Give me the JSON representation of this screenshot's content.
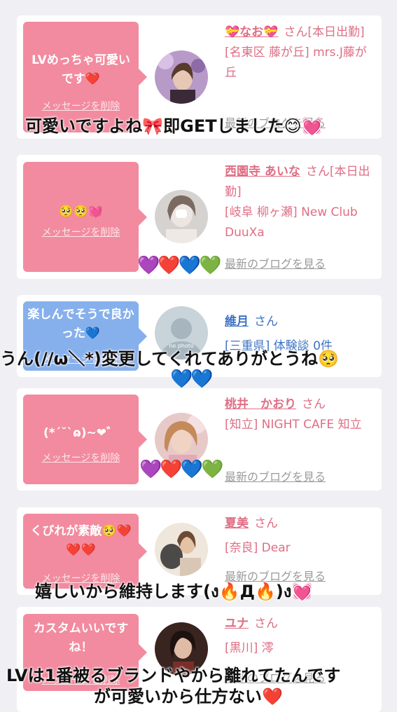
{
  "cards": [
    {
      "bubble_message": "LVめっちゃ可愛いです❤️",
      "delete_label": "メッセージを削除",
      "name": "💝なお💝",
      "honorific": "さん[本日出勤]",
      "place": "[名東区 藤が丘] mrs.J藤が丘",
      "blog_label": "最新のブログを見る"
    },
    {
      "bubble_message": "🥺🥺💓",
      "delete_label": "メッセージを削除",
      "name": "西園寺 あいな",
      "honorific": "さん[本日出勤]",
      "place": "[岐阜 柳ヶ瀬] New Club DuuXa",
      "blog_label": "最新のブログを見る"
    },
    {
      "bubble_message": "楽しんでそうで良かった💙",
      "delete_label": "メッセージを削除",
      "name": "維月",
      "honorific": "さん",
      "place": "[三重県] 体験談 0件",
      "avatar_text": "no photo"
    },
    {
      "bubble_message": "(*´˘`ɷ)~❤︎゛",
      "delete_label": "メッセージを削除",
      "name": "桃井　かおり",
      "honorific": "さん",
      "place": "[知立] NIGHT CAFE 知立",
      "blog_label": "最新のブログを見る"
    },
    {
      "bubble_message": "くびれが素敵🥺❤️❤️❤️",
      "delete_label": "メッセージを削除",
      "name": "夏美",
      "honorific": "さん",
      "place": "[奈良] Dear",
      "blog_label": "最新のブログを見る"
    },
    {
      "bubble_message": "カスタムいいですね！",
      "delete_label": "メッセージを削除",
      "name": "ユナ",
      "honorific": "さん",
      "place": "[黒川] 澪",
      "blog_label": "最新のブログを見る"
    }
  ],
  "overlays": {
    "caption_1": "可愛いですよね🎀即GETしました😊💓",
    "hearts_1": "💜❤️💙💚",
    "caption_2": "うん(//ω＼*)変更してくれてありがとうね🥺",
    "hearts_2": "💙💙",
    "hearts_3": "💜❤️💙💚",
    "caption_3": "嬉しいから維持します(ง🔥Д🔥)ง💓",
    "caption_4_line1": "LVは1番被るブランドやから離れてたんです",
    "caption_4_line2": "が可愛いから仕方ない❤️"
  },
  "colors": {
    "pink_bubble": "#f28b9f",
    "blue_bubble": "#86b0ec",
    "pink_text": "#de6e84",
    "blue_text": "#3e73c4"
  }
}
